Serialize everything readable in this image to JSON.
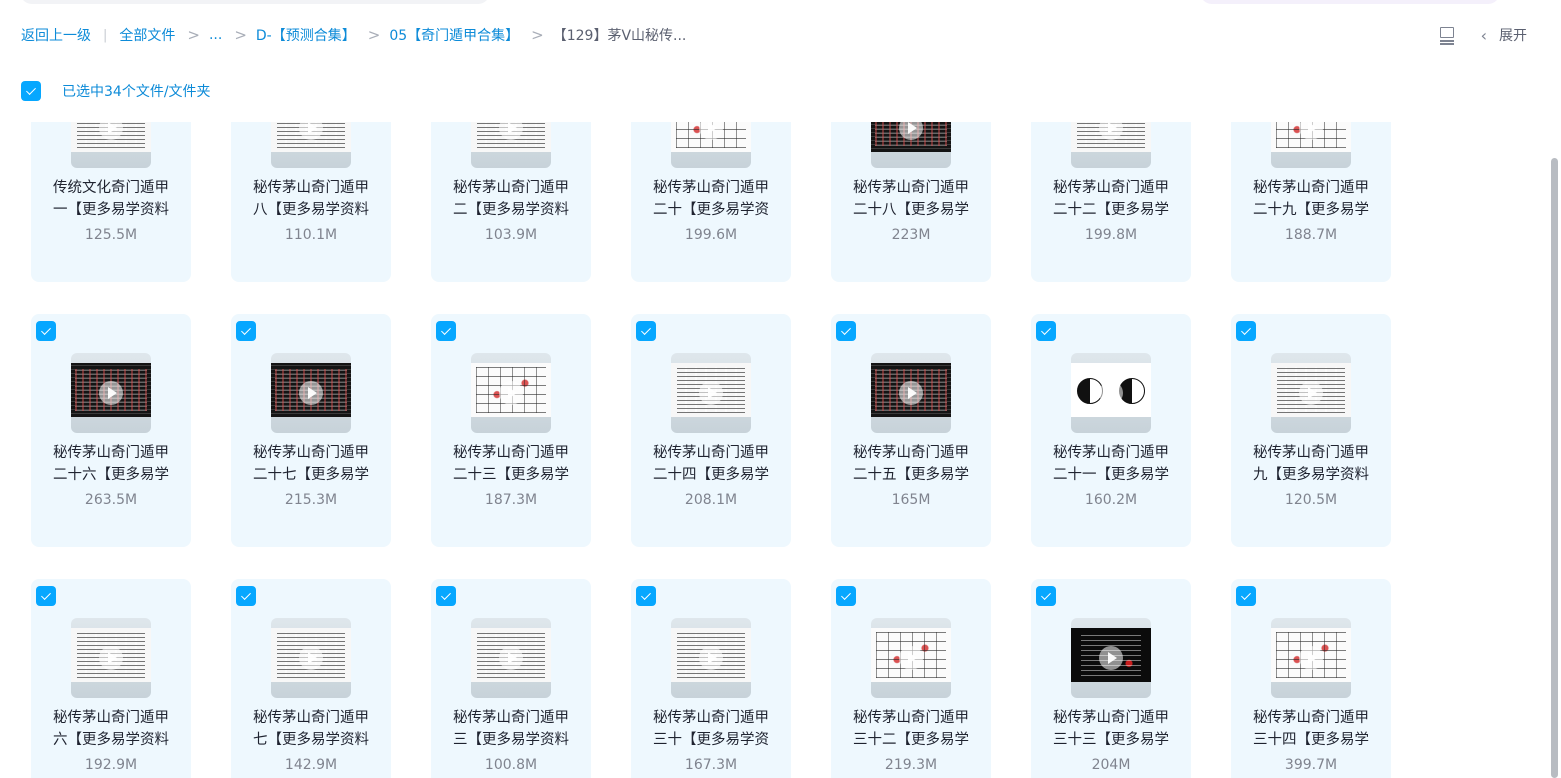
{
  "breadcrumb": {
    "back": "返回上一级",
    "root": "全部文件",
    "ellipsis": "...",
    "level1": "D-【预测合集】",
    "level2": "05【奇门遁甲合集】",
    "current": "【129】茅V山秘传..."
  },
  "toolbar": {
    "expand_label": "展开"
  },
  "selection": {
    "text": "已选中34个文件/文件夹"
  },
  "accent_color": "#06a7ff",
  "files": [
    {
      "line1": "传统文化奇门遁甲",
      "line2": "一【更多易学资料",
      "size": "125.5M",
      "thumb": "doc"
    },
    {
      "line1": "秘传茅山奇门遁甲",
      "line2": "八【更多易学资料",
      "size": "110.1M",
      "thumb": "doc"
    },
    {
      "line1": "秘传茅山奇门遁甲",
      "line2": "二【更多易学资料",
      "size": "103.9M",
      "thumb": "doc"
    },
    {
      "line1": "秘传茅山奇门遁甲",
      "line2": "二十【更多易学资",
      "size": "199.6M",
      "thumb": "red"
    },
    {
      "line1": "秘传茅山奇门遁甲",
      "line2": "二十八【更多易学",
      "size": "223M",
      "thumb": "dark"
    },
    {
      "line1": "秘传茅山奇门遁甲",
      "line2": "二十二【更多易学",
      "size": "199.8M",
      "thumb": "doc"
    },
    {
      "line1": "秘传茅山奇门遁甲",
      "line2": "二十九【更多易学",
      "size": "188.7M",
      "thumb": "red"
    },
    {
      "line1": "秘传茅山奇门遁甲",
      "line2": "二十六【更多易学",
      "size": "263.5M",
      "thumb": "dark"
    },
    {
      "line1": "秘传茅山奇门遁甲",
      "line2": "二十七【更多易学",
      "size": "215.3M",
      "thumb": "dark"
    },
    {
      "line1": "秘传茅山奇门遁甲",
      "line2": "二十三【更多易学",
      "size": "187.3M",
      "thumb": "red"
    },
    {
      "line1": "秘传茅山奇门遁甲",
      "line2": "二十四【更多易学",
      "size": "208.1M",
      "thumb": "doc"
    },
    {
      "line1": "秘传茅山奇门遁甲",
      "line2": "二十五【更多易学",
      "size": "165M",
      "thumb": "dark"
    },
    {
      "line1": "秘传茅山奇门遁甲",
      "line2": "二十一【更多易学",
      "size": "160.2M",
      "thumb": "yy"
    },
    {
      "line1": "秘传茅山奇门遁甲",
      "line2": "九【更多易学资料",
      "size": "120.5M",
      "thumb": "doc"
    },
    {
      "line1": "秘传茅山奇门遁甲",
      "line2": "六【更多易学资料",
      "size": "192.9M",
      "thumb": "doc"
    },
    {
      "line1": "秘传茅山奇门遁甲",
      "line2": "七【更多易学资料",
      "size": "142.9M",
      "thumb": "doc"
    },
    {
      "line1": "秘传茅山奇门遁甲",
      "line2": "三【更多易学资料",
      "size": "100.8M",
      "thumb": "doc"
    },
    {
      "line1": "秘传茅山奇门遁甲",
      "line2": "三十【更多易学资",
      "size": "167.3M",
      "thumb": "doc"
    },
    {
      "line1": "秘传茅山奇门遁甲",
      "line2": "三十二【更多易学",
      "size": "219.3M",
      "thumb": "red"
    },
    {
      "line1": "秘传茅山奇门遁甲",
      "line2": "三十三【更多易学",
      "size": "204M",
      "thumb": "black"
    },
    {
      "line1": "秘传茅山奇门遁甲",
      "line2": "三十四【更多易学",
      "size": "399.7M",
      "thumb": "red"
    }
  ]
}
